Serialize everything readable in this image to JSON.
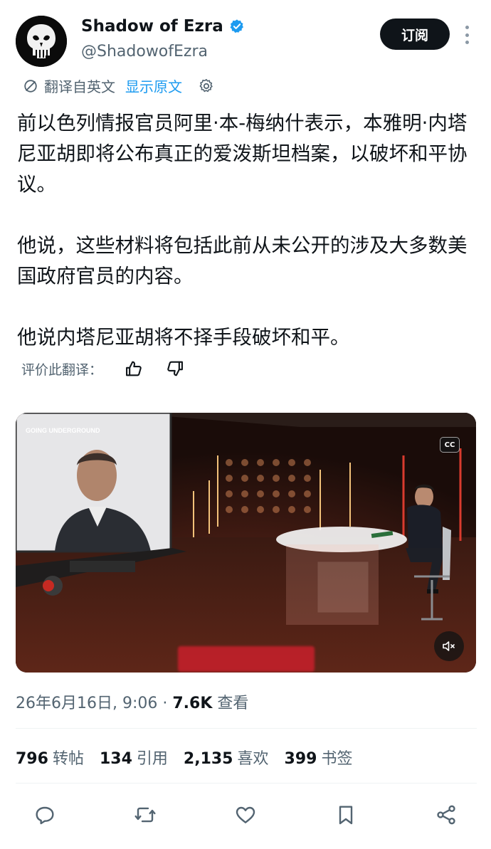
{
  "header": {
    "display_name": "Shadow of Ezra",
    "handle": "@ShadowofEzra",
    "subscribe_label": "订阅"
  },
  "translation": {
    "translated_label": "翻译自英文",
    "show_original_label": "显示原文"
  },
  "tweet": {
    "paragraphs": [
      "前以色列情报官员阿里·本-梅纳什表示，本雅明·内塔尼亚胡即将公布真正的爱泼斯坦档案，以破坏和平协议。",
      "他说，这些材料将包括此前从未公开的涉及大多数美国政府官员的内容。",
      "他说内塔尼亚胡将不择手段破坏和平。"
    ]
  },
  "rate": {
    "label": "评价此翻译："
  },
  "video": {
    "watermark": "GOING UNDERGROUND",
    "cc_label": "CC"
  },
  "meta": {
    "date": "26年6月16日, 9:06 · ",
    "views_count": "7.6K",
    "views_label": " 查看"
  },
  "stats": {
    "reposts": {
      "num": "796",
      "label": "转帖"
    },
    "quotes": {
      "num": "134",
      "label": "引用"
    },
    "likes": {
      "num": "2,135",
      "label": "喜欢"
    },
    "bookmarks": {
      "num": "399",
      "label": "书签"
    }
  },
  "colors": {
    "accent": "#1d9bf0",
    "text": "#0f1419",
    "secondary": "#536471",
    "button_bg": "#0f1419"
  },
  "icons": {
    "verified": "verified-badge-icon",
    "translate": "translate-icon",
    "gear": "gear-icon",
    "thumb_up": "thumb-up-icon",
    "thumb_down": "thumb-down-icon",
    "mute": "mute-icon",
    "reply": "reply-icon",
    "repost": "repost-icon",
    "like": "like-icon",
    "bookmark": "bookmark-icon",
    "share": "share-icon"
  }
}
